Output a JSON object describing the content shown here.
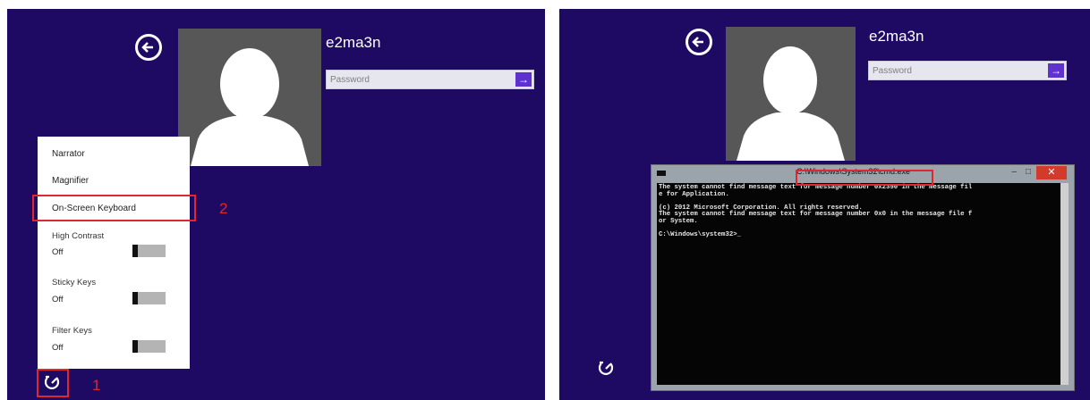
{
  "left": {
    "username": "e2ma3n",
    "password_placeholder": "Password",
    "go_symbol": "→",
    "back_icon": "back-arrow-icon",
    "ease_icon": "ease-of-access-icon",
    "menu": {
      "items": [
        "Narrator",
        "Magnifier",
        "On-Screen Keyboard"
      ],
      "toggles": [
        {
          "label": "High Contrast",
          "value": "Off"
        },
        {
          "label": "Sticky Keys",
          "value": "Off"
        },
        {
          "label": "Filter Keys",
          "value": "Off"
        }
      ]
    },
    "callouts": {
      "step1": "1",
      "step2": "2"
    },
    "highlight_color": "#e0262e"
  },
  "right": {
    "username": "e2ma3n",
    "password_placeholder": "Password",
    "go_symbol": "→",
    "ease_icon": "ease-of-access-icon",
    "cmd": {
      "title": "C:\\Windows\\System32\\cmd.exe",
      "minimize": "–",
      "maximize": "□",
      "close": "✕",
      "lines": [
        "The system cannot find message text for message number 0x2350 in the message fil",
        "e for Application.",
        "",
        "(c) 2012 Microsoft Corporation. All rights reserved.",
        "The system cannot find message text for message number 0x0 in the message file f",
        "or System.",
        "",
        "C:\\Windows\\system32>_"
      ]
    }
  },
  "colors": {
    "background": "#1e0a63",
    "accent": "#5f32d0",
    "avatar": "#575757"
  }
}
